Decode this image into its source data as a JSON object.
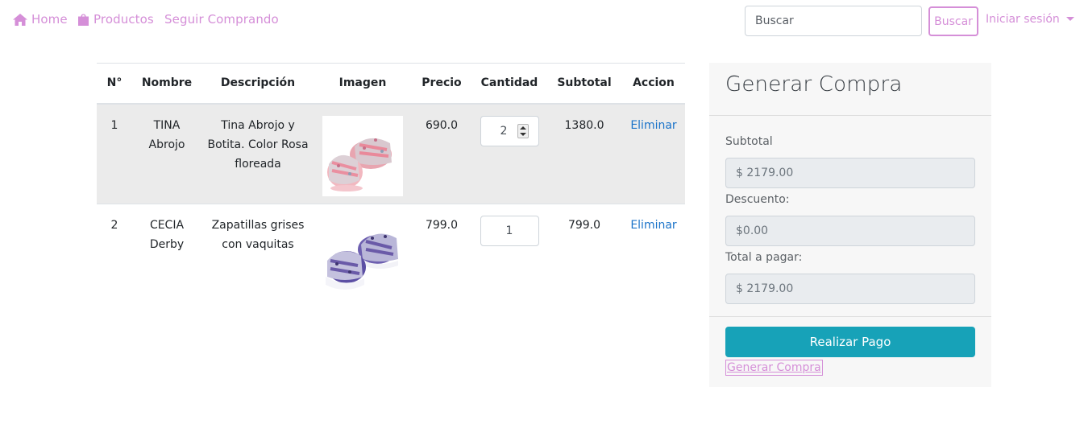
{
  "navbar": {
    "home_label": "Home",
    "productos_label": "Productos",
    "seguir_label": "Seguir Comprando",
    "search_placeholder": "Buscar",
    "search_button": "Buscar",
    "login_label": "Iniciar sesión",
    "accent_color": "#d58fd8"
  },
  "table": {
    "headers": [
      "N°",
      "Nombre",
      "Descripción",
      "Imagen",
      "Precio",
      "Cantidad",
      "Subtotal",
      "Accion"
    ],
    "rows": [
      {
        "num": "1",
        "nombre": "TINA Abrojo",
        "descripcion": "Tina Abrojo y Botita. Color Rosa floreada",
        "image_icon": "pink-baby-shoes-image",
        "precio": "690.0",
        "cantidad": "2",
        "subtotal": "1380.0",
        "accion": "Eliminar"
      },
      {
        "num": "2",
        "nombre": "CECIA Derby",
        "descripcion": "Zapatillas grises con vaquitas",
        "image_icon": "blue-baby-sneakers-image",
        "precio": "799.0",
        "cantidad": "1",
        "subtotal": "799.0",
        "accion": "Eliminar"
      }
    ]
  },
  "summary": {
    "title": "Generar Compra",
    "subtotal_label": "Subtotal",
    "subtotal_value": "$ 2179.00",
    "descuento_label": "Descuento:",
    "descuento_value": "$0.00",
    "total_label": "Total a pagar:",
    "total_value": "$ 2179.00",
    "pay_button": "Realizar Pago",
    "generate_link": "Generar Compra",
    "pay_color": "#17a2b8"
  }
}
